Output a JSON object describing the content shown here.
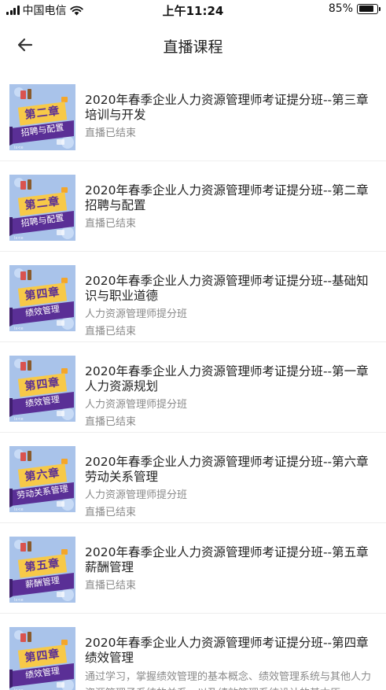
{
  "status_bar": {
    "carrier": "中国电信",
    "time": "上午11:24",
    "battery": "85%",
    "battery_level": 0.85
  },
  "header": {
    "back_icon": "arrow-left-icon",
    "title": "直播课程"
  },
  "colors": {
    "thumb_background": "#a9c3ea",
    "thumb_banner": "#5a2f96",
    "thumb_title_bg": "#f7c948",
    "meta_text": "#8a8a8a"
  },
  "courses": [
    {
      "title": "2020年春季企业人力资源管理师考证提分班--第三章培训与开发",
      "thumb_title": "第二章",
      "thumb_subtitle": "招聘与配置",
      "meta1": "直播已结束",
      "meta2": ""
    },
    {
      "title": "2020年春季企业人力资源管理师考证提分班--第二章招聘与配置",
      "thumb_title": "第二章",
      "thumb_subtitle": "招聘与配置",
      "meta1": "直播已结束",
      "meta2": ""
    },
    {
      "title": "2020年春季企业人力资源管理师考证提分班--基础知识与职业道德",
      "thumb_title": "第四章",
      "thumb_subtitle": "绩效管理",
      "meta1": "人力资源管理师提分班",
      "meta2": "直播已结束"
    },
    {
      "title": "2020年春季企业人力资源管理师考证提分班--第一章人力资源规划",
      "thumb_title": "第四章",
      "thumb_subtitle": "绩效管理",
      "meta1": "人力资源管理师提分班",
      "meta2": "直播已结束"
    },
    {
      "title": "2020年春季企业人力资源管理师考证提分班--第六章劳动关系管理",
      "thumb_title": "第六章",
      "thumb_subtitle": "劳动关系管理",
      "meta1": "人力资源管理师提分班",
      "meta2": "直播已结束"
    },
    {
      "title": "2020年春季企业人力资源管理师考证提分班--第五章薪酬管理",
      "thumb_title": "第五章",
      "thumb_subtitle": "薪酬管理",
      "meta1": "直播已结束",
      "meta2": ""
    },
    {
      "title": "2020年春季企业人力资源管理师考证提分班--第四章绩效管理",
      "thumb_title": "第四章",
      "thumb_subtitle": "绩效管理",
      "meta1": "通过学习，掌握绩效管理的基本概念、绩效管理系统与其他人力资源管理子系统的关系，以及绩效管理系统设计的基本原…",
      "meta2": ""
    }
  ]
}
